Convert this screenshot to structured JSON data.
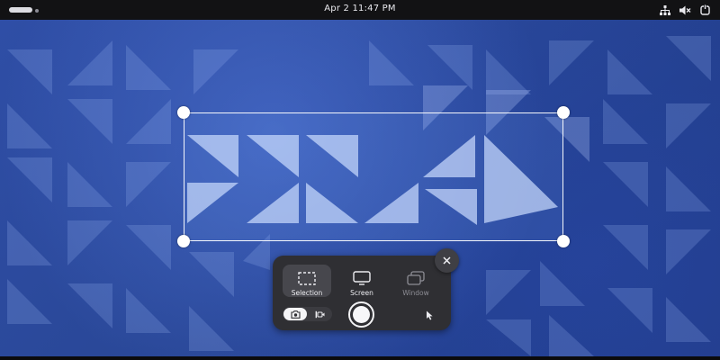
{
  "topbar": {
    "clock": "Apr 2  11:47 PM",
    "icons": [
      "network-icon",
      "volume-muted-icon",
      "power-icon"
    ]
  },
  "screenshot_ui": {
    "modes": [
      {
        "label": "Selection",
        "icon": "selection-icon",
        "active": true
      },
      {
        "label": "Screen",
        "icon": "monitor-icon",
        "active": false
      },
      {
        "label": "Window",
        "icon": "window-icon",
        "active": false,
        "disabled": true
      }
    ],
    "capture_type": {
      "selected": "screenshot",
      "options": [
        "camera-icon",
        "screencast-icon"
      ]
    },
    "pointer_icon": "cursor-icon",
    "close_icon": "close-icon"
  },
  "colors": {
    "wallpaper": "#2a4899",
    "panel": "#2f2f33",
    "active_mode": "#47474d",
    "topbar": "#121214"
  }
}
